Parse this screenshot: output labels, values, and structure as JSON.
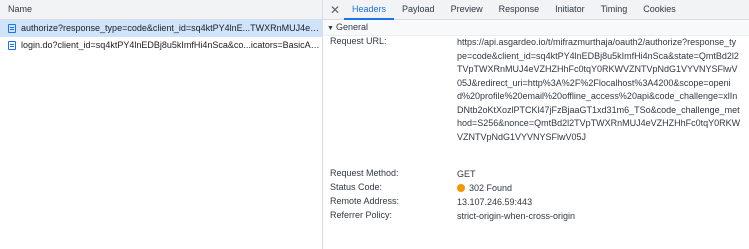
{
  "requests_panel": {
    "header": "Name",
    "rows": [
      {
        "label": "authorize?response_type=code&client_id=sq4ktPY4lnE...TWXRnMUJ4eVZ...",
        "selected": true
      },
      {
        "label": "login.do?client_id=sq4ktPY4lnEDBj8u5kImfHi4nSca&co...icators=BasicAu...",
        "selected": false
      }
    ]
  },
  "tabs": [
    "Headers",
    "Payload",
    "Preview",
    "Response",
    "Initiator",
    "Timing",
    "Cookies"
  ],
  "active_tab": "Headers",
  "section": {
    "title": "General"
  },
  "general": {
    "request_url_label": "Request URL:",
    "request_url_value": "https://api.asgardeo.io/t/mifrazmurthaja/oauth2/authorize?response_type=code&client_id=sq4ktPY4lnEDBj8u5kImfHi4nSca&state=QmtBd2l2TVpTWXRnMUJ4eVZHZHhFc0tqY0RKWVZNTVpNdG1VYVNYSFlwV05J&redirect_uri=http%3A%2F%2Flocalhost%3A4200&scope=openid%20profile%20email%20offline_access%20api&code_challenge=xlInDNtb2oKtXozlPTCKl47jFzBjaaGT1xd31m6_TSo&code_challenge_method=S256&nonce=QmtBd2l2TVpTWXRnMUJ4eVZHZHhFc0tqY0RKWVZNTVpNdG1VYVNYSFlwV05J",
    "request_method_label": "Request Method:",
    "request_method_value": "GET",
    "status_code_label": "Status Code:",
    "status_code_value": "302 Found",
    "status_color": "#f29900",
    "remote_address_label": "Remote Address:",
    "remote_address_value": "13.107.246.59:443",
    "referrer_policy_label": "Referrer Policy:",
    "referrer_policy_value": "strict-origin-when-cross-origin"
  },
  "colors": {
    "accent": "#1a73e8",
    "selected_row": "#cfe3fb",
    "status_dot": "#f29900"
  },
  "icons": {
    "close": "close-icon",
    "request_row": "document-icon",
    "section_toggle": "triangle-down-icon"
  }
}
